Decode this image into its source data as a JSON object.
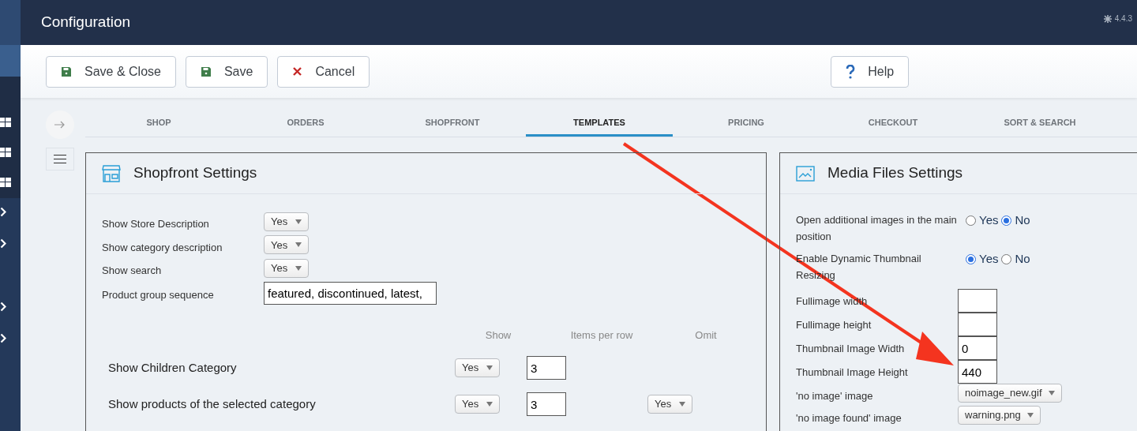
{
  "header": {
    "title": "Configuration",
    "version": "4.4.3"
  },
  "toolbar": [
    {
      "label": "Save & Close",
      "kind": "save"
    },
    {
      "label": "Save",
      "kind": "save"
    },
    {
      "label": "Cancel",
      "kind": "cancel"
    },
    {
      "label": "Help",
      "kind": "help"
    }
  ],
  "tabs": [
    {
      "label": "SHOP",
      "selected": false
    },
    {
      "label": "ORDERS",
      "selected": false
    },
    {
      "label": "SHOPFRONT",
      "selected": false
    },
    {
      "label": "TEMPLATES",
      "selected": true
    },
    {
      "label": "PRICING",
      "selected": false
    },
    {
      "label": "CHECKOUT",
      "selected": false
    },
    {
      "label": "SORT & SEARCH",
      "selected": false
    }
  ],
  "shopfront": {
    "title": "Shopfront Settings",
    "fields": [
      {
        "label": "Show Store Description",
        "kind": "select",
        "value": "Yes"
      },
      {
        "label": "Show category description",
        "kind": "select",
        "value": "Yes"
      },
      {
        "label": "Show search",
        "kind": "select",
        "value": "Yes"
      },
      {
        "label": "Product group sequence",
        "kind": "text",
        "value": "featured, discontinued, latest,"
      }
    ],
    "columns": [
      "Show",
      "Items per row",
      "Omit"
    ],
    "rows": [
      {
        "label": "Show Children Category",
        "show": "Yes",
        "items_per_row": "3"
      },
      {
        "label": "Show products of the selected category",
        "show": "Yes",
        "items_per_row": "3",
        "omit": "Yes"
      }
    ]
  },
  "media": {
    "title": "Media Files Settings",
    "fields": [
      {
        "label": "Open additional images in the main position",
        "kind": "radio",
        "options": [
          {
            "label": "Yes",
            "selected": false
          },
          {
            "label": "No",
            "selected": true
          }
        ]
      },
      {
        "label": "Enable Dynamic Thumbnail Resizing",
        "kind": "radio",
        "options": [
          {
            "label": "Yes",
            "selected": true
          },
          {
            "label": "No",
            "selected": false
          }
        ]
      },
      {
        "label": "Fullimage width",
        "kind": "text"
      },
      {
        "label": "Fullimage height",
        "kind": "text"
      },
      {
        "label": "Thumbnail Image Width",
        "kind": "text",
        "value": "0"
      },
      {
        "label": "Thumbnail Image Height",
        "kind": "text",
        "value": "440"
      },
      {
        "label": "'no image' image",
        "kind": "select",
        "value": "noimage_new.gif"
      },
      {
        "label": "'no image found' image",
        "kind": "select",
        "value": "warning.png"
      }
    ]
  }
}
